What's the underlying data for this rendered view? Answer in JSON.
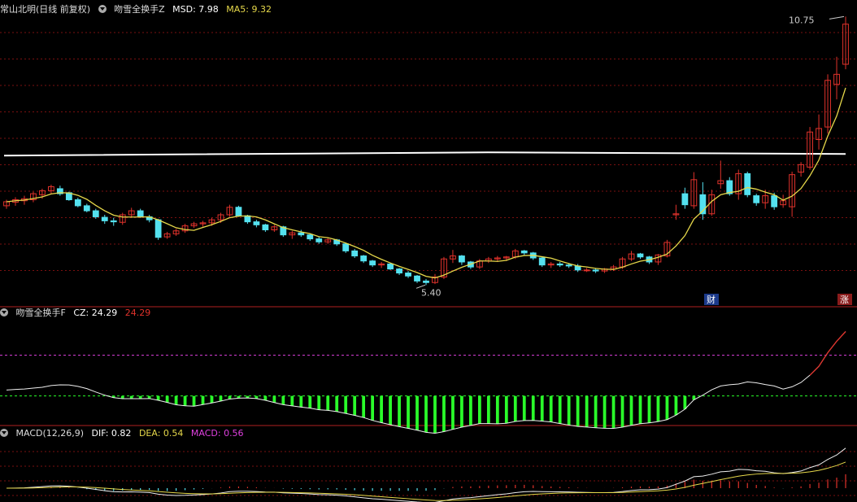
{
  "main_panel": {
    "title": "常山北明(日线 前复权)",
    "indicator_name": "吻雪全换手Z",
    "msd_label": "MSD: 7.98",
    "ma5_label": "MA5: 9.32",
    "high_label": "10.75",
    "low_label": "5.40",
    "marker_cai": "财",
    "marker_zhang": "涨"
  },
  "sub_panel_1": {
    "indicator_name": "吻雪全换手F",
    "cz_label": "CZ: 24.29",
    "cz_value_red": "24.29"
  },
  "sub_panel_2": {
    "indicator_name": "MACD(12,26,9)",
    "dif_label": "DIF: 0.82",
    "dea_label": "DEA: 0.54",
    "macd_label": "MACD: 0.56"
  },
  "colors": {
    "up": "#e0322b",
    "down": "#54e1ef",
    "ma": "#e6d84a",
    "msd_line": "#ffffff",
    "grid": "#7a1010",
    "cz_green": "#2aff2a",
    "macd_magenta": "#e040e0"
  },
  "chart_data": [
    {
      "type": "candlestick",
      "title": "常山北明(日线 前复权)",
      "note": "daily OHLC prices, 5-day MA; horizontal MSD level",
      "msd_level": 7.98,
      "ma5_last": 9.32,
      "ohlc": [
        [
          6.98,
          7.1,
          6.92,
          7.06
        ],
        [
          7.05,
          7.15,
          6.98,
          7.1
        ],
        [
          7.08,
          7.18,
          7.0,
          7.12
        ],
        [
          7.1,
          7.26,
          7.05,
          7.22
        ],
        [
          7.2,
          7.32,
          7.12,
          7.28
        ],
        [
          7.28,
          7.4,
          7.22,
          7.36
        ],
        [
          7.32,
          7.38,
          7.18,
          7.22
        ],
        [
          7.24,
          7.26,
          7.08,
          7.1
        ],
        [
          7.1,
          7.14,
          6.95,
          6.98
        ],
        [
          6.98,
          7.02,
          6.85,
          6.88
        ],
        [
          6.88,
          6.92,
          6.72,
          6.76
        ],
        [
          6.75,
          6.8,
          6.62,
          6.68
        ],
        [
          6.68,
          6.74,
          6.58,
          6.66
        ],
        [
          6.65,
          6.84,
          6.6,
          6.8
        ],
        [
          6.8,
          6.94,
          6.74,
          6.88
        ],
        [
          6.88,
          6.92,
          6.74,
          6.76
        ],
        [
          6.76,
          6.8,
          6.65,
          6.7
        ],
        [
          6.7,
          6.72,
          6.3,
          6.35
        ],
        [
          6.36,
          6.46,
          6.32,
          6.42
        ],
        [
          6.42,
          6.52,
          6.38,
          6.48
        ],
        [
          6.48,
          6.62,
          6.44,
          6.58
        ],
        [
          6.58,
          6.66,
          6.54,
          6.62
        ],
        [
          6.62,
          6.68,
          6.56,
          6.64
        ],
        [
          6.64,
          6.74,
          6.58,
          6.7
        ],
        [
          6.7,
          6.84,
          6.64,
          6.8
        ],
        [
          6.8,
          7.0,
          6.76,
          6.95
        ],
        [
          6.95,
          6.98,
          6.76,
          6.78
        ],
        [
          6.78,
          6.8,
          6.62,
          6.66
        ],
        [
          6.66,
          6.7,
          6.55,
          6.6
        ],
        [
          6.6,
          6.62,
          6.46,
          6.5
        ],
        [
          6.5,
          6.6,
          6.46,
          6.56
        ],
        [
          6.56,
          6.58,
          6.36,
          6.4
        ],
        [
          6.4,
          6.48,
          6.32,
          6.44
        ],
        [
          6.44,
          6.5,
          6.36,
          6.4
        ],
        [
          6.4,
          6.42,
          6.28,
          6.32
        ],
        [
          6.32,
          6.36,
          6.22,
          6.26
        ],
        [
          6.26,
          6.34,
          6.22,
          6.3
        ],
        [
          6.3,
          6.32,
          6.18,
          6.22
        ],
        [
          6.22,
          6.24,
          6.04,
          6.08
        ],
        [
          6.08,
          6.12,
          5.94,
          5.98
        ],
        [
          5.98,
          6.0,
          5.84,
          5.88
        ],
        [
          5.88,
          5.9,
          5.76,
          5.8
        ],
        [
          5.8,
          5.86,
          5.74,
          5.82
        ],
        [
          5.82,
          5.84,
          5.7,
          5.72
        ],
        [
          5.72,
          5.74,
          5.6,
          5.64
        ],
        [
          5.64,
          5.68,
          5.54,
          5.58
        ],
        [
          5.58,
          5.6,
          5.44,
          5.48
        ],
        [
          5.48,
          5.52,
          5.4,
          5.45
        ],
        [
          5.45,
          5.62,
          5.42,
          5.56
        ],
        [
          5.56,
          5.96,
          5.52,
          5.92
        ],
        [
          5.92,
          6.1,
          5.84,
          5.98
        ],
        [
          5.98,
          6.0,
          5.8,
          5.86
        ],
        [
          5.86,
          5.88,
          5.72,
          5.76
        ],
        [
          5.76,
          5.92,
          5.72,
          5.88
        ],
        [
          5.88,
          5.96,
          5.84,
          5.92
        ],
        [
          5.92,
          5.98,
          5.86,
          5.94
        ],
        [
          5.94,
          5.98,
          5.88,
          5.96
        ],
        [
          5.96,
          6.12,
          5.92,
          6.08
        ],
        [
          6.08,
          6.1,
          6.0,
          6.04
        ],
        [
          6.04,
          6.06,
          5.9,
          5.94
        ],
        [
          5.94,
          5.96,
          5.76,
          5.8
        ],
        [
          5.8,
          5.86,
          5.74,
          5.82
        ],
        [
          5.82,
          5.86,
          5.76,
          5.8
        ],
        [
          5.8,
          5.84,
          5.74,
          5.78
        ],
        [
          5.78,
          5.82,
          5.66,
          5.7
        ],
        [
          5.7,
          5.74,
          5.66,
          5.7
        ],
        [
          5.7,
          5.74,
          5.64,
          5.68
        ],
        [
          5.68,
          5.74,
          5.64,
          5.72
        ],
        [
          5.72,
          5.8,
          5.68,
          5.76
        ],
        [
          5.76,
          5.96,
          5.72,
          5.92
        ],
        [
          5.92,
          6.08,
          5.88,
          6.02
        ],
        [
          6.02,
          6.04,
          5.92,
          5.96
        ],
        [
          5.96,
          5.98,
          5.82,
          5.86
        ],
        [
          5.86,
          6.02,
          5.8,
          6.0
        ],
        [
          5.98,
          6.3,
          5.95,
          6.25
        ],
        [
          6.8,
          7.0,
          6.7,
          6.82
        ],
        [
          7.22,
          7.34,
          6.92,
          7.0
        ],
        [
          6.98,
          7.65,
          6.92,
          7.5
        ],
        [
          7.2,
          7.45,
          6.7,
          6.82
        ],
        [
          6.82,
          7.3,
          6.78,
          7.2
        ],
        [
          7.42,
          7.88,
          7.32,
          7.48
        ],
        [
          7.48,
          7.55,
          7.18,
          7.22
        ],
        [
          7.22,
          7.7,
          7.1,
          7.62
        ],
        [
          7.62,
          7.66,
          7.15,
          7.2
        ],
        [
          7.18,
          7.22,
          6.98,
          7.04
        ],
        [
          7.04,
          7.3,
          6.92,
          7.18
        ],
        [
          7.18,
          7.24,
          6.9,
          6.96
        ],
        [
          7.0,
          7.2,
          6.94,
          7.08
        ],
        [
          6.96,
          7.66,
          6.76,
          7.6
        ],
        [
          7.65,
          7.85,
          7.56,
          7.8
        ],
        [
          7.75,
          8.55,
          7.7,
          8.45
        ],
        [
          8.3,
          8.8,
          8.1,
          8.52
        ],
        [
          8.55,
          9.6,
          8.42,
          9.48
        ],
        [
          9.4,
          9.95,
          9.1,
          9.6
        ],
        [
          9.8,
          10.75,
          9.7,
          10.6
        ]
      ]
    },
    {
      "type": "line",
      "title": "吻雪全换手F",
      "reference_levels": [
        60,
        0
      ],
      "last_value": 24.29
    },
    {
      "type": "bar",
      "title": "MACD(12,26,9)",
      "dif_last": 0.82,
      "dea_last": 0.54,
      "macd_last": 0.56
    }
  ]
}
